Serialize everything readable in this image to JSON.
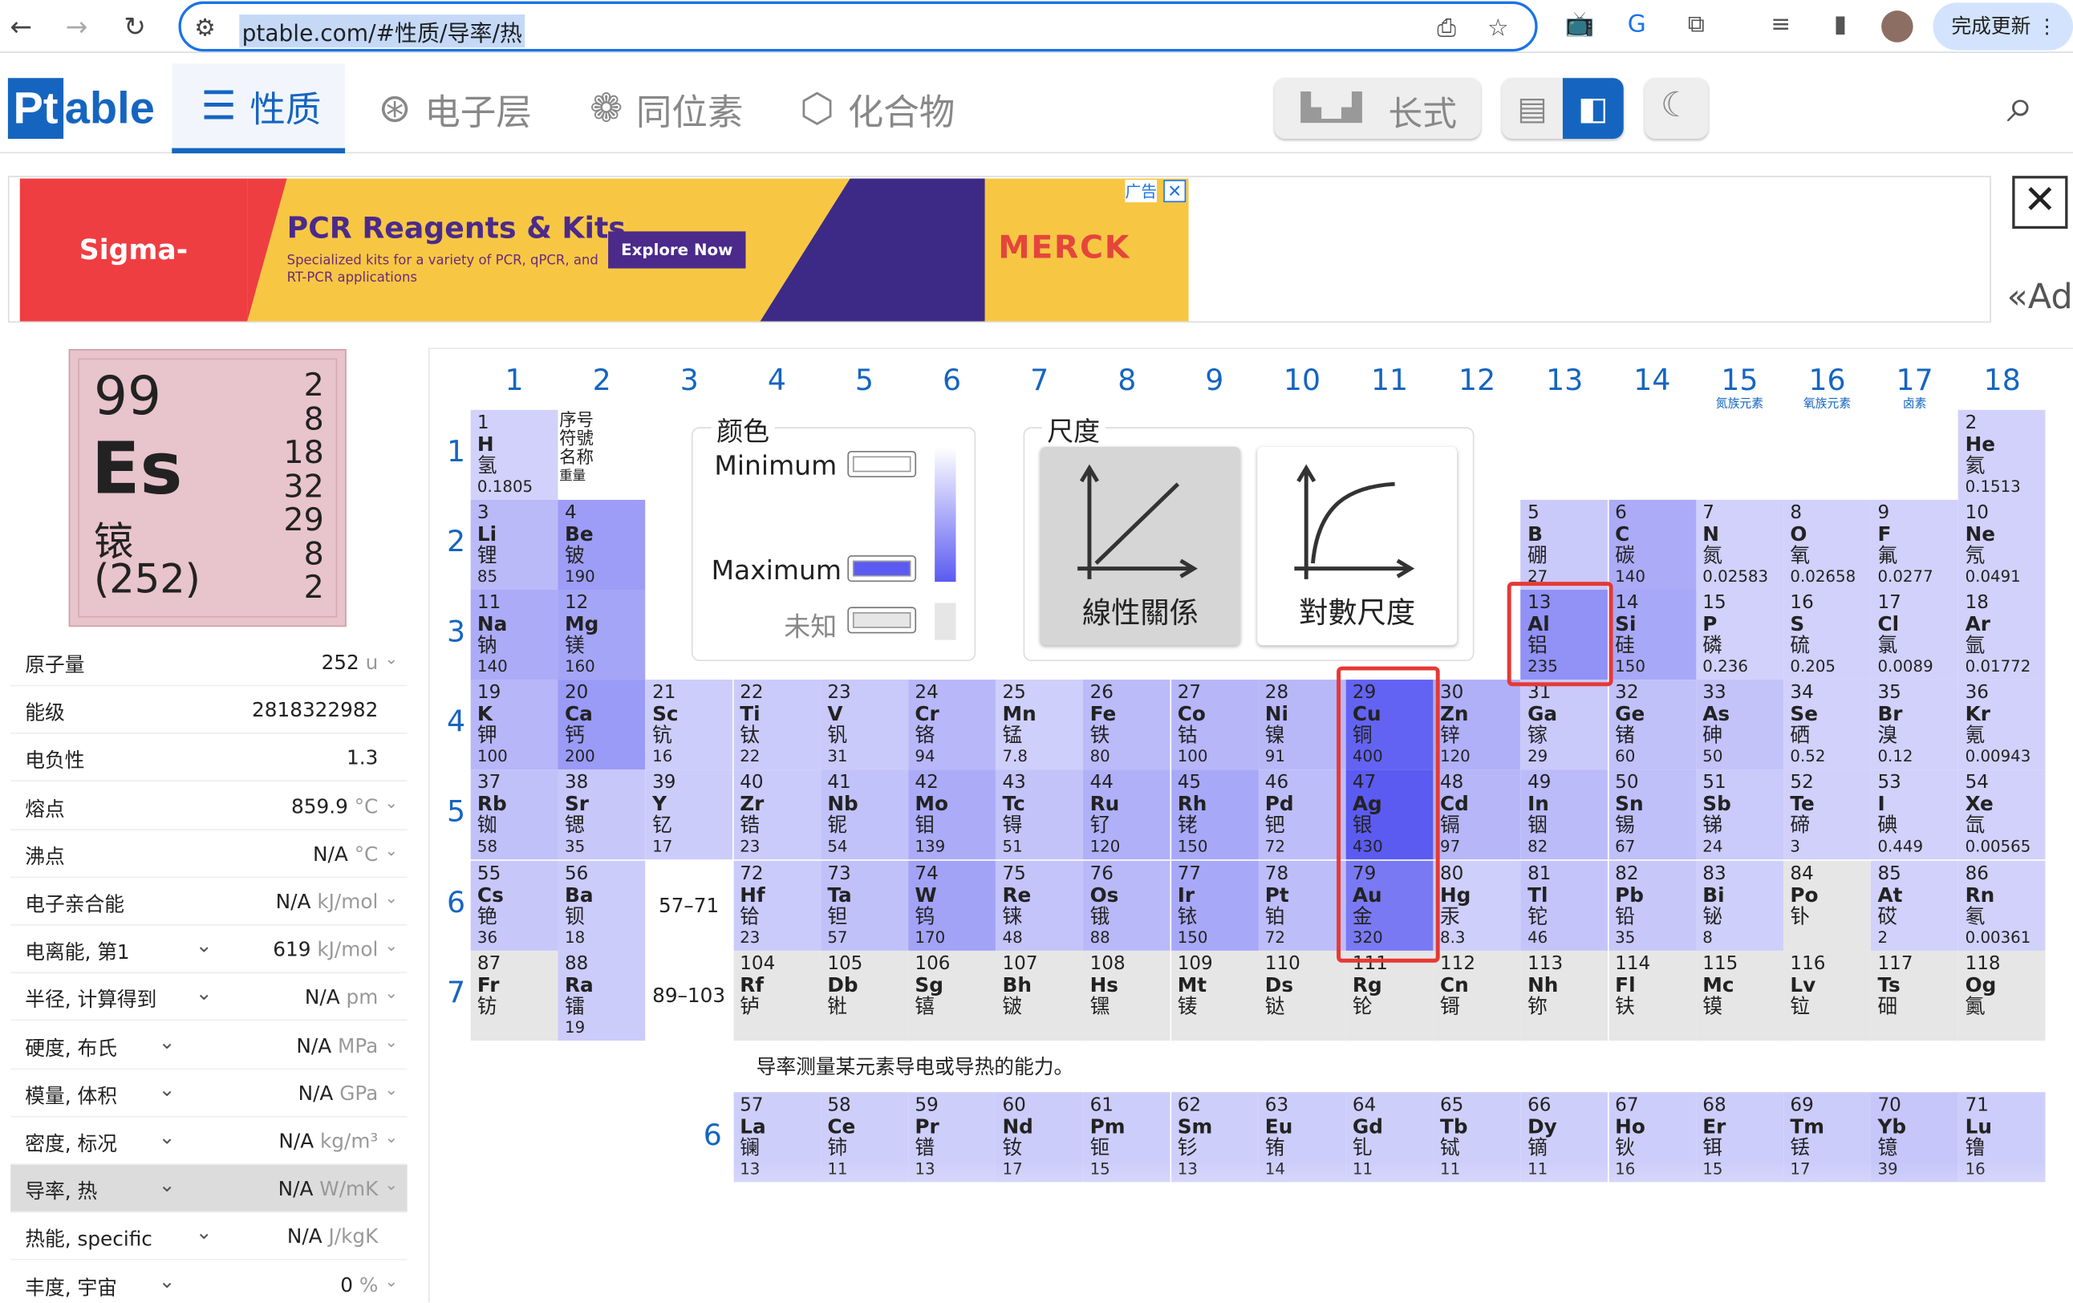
{
  "browser": {
    "url": "ptable.com/#性质/导率/热",
    "update_label": "完成更新"
  },
  "app": {
    "logo_pt": "Pt",
    "logo_able": "able",
    "tabs": [
      {
        "label": "性质",
        "icon": "list-icon",
        "active": true
      },
      {
        "label": "电子层",
        "icon": "atom-icon",
        "active": false
      },
      {
        "label": "同位素",
        "icon": "isotope-icon",
        "active": false
      },
      {
        "label": "化合物",
        "icon": "molecule-icon",
        "active": false
      }
    ],
    "layout_label": "长式"
  },
  "ad": {
    "brand": "Sigma-Aldrich.",
    "title": "PCR Reagents & Kits",
    "subtitle": "Specialized kits for a variety of PCR, qPCR, and RT-PCR applications",
    "button": "Explore Now",
    "sponsor": "MERCK",
    "tag": "广告",
    "side_text": "«Ad"
  },
  "selected": {
    "number": "99",
    "symbol": "Es",
    "name": "锿",
    "weight": "(252)",
    "shells": [
      "2",
      "8",
      "18",
      "32",
      "29",
      "8",
      "2"
    ],
    "color": "#e8c4cc"
  },
  "properties": [
    {
      "label": "原子量",
      "value": "252",
      "unit": "u",
      "chev": true,
      "dd": false
    },
    {
      "label": "能级",
      "value": "2818322982",
      "unit": "",
      "chev": false,
      "dd": false
    },
    {
      "label": "电负性",
      "value": "1.3",
      "unit": "",
      "chev": false,
      "dd": false
    },
    {
      "label": "熔点",
      "value": "859.9",
      "unit": "°C",
      "chev": true,
      "dd": false
    },
    {
      "label": "沸点",
      "value": "N/A",
      "unit": "°C",
      "chev": true,
      "dd": false
    },
    {
      "label": "电子亲合能",
      "value": "N/A",
      "unit": "kJ/mol",
      "chev": true,
      "dd": false
    },
    {
      "label": "电离能, 第1",
      "value": "619",
      "unit": "kJ/mol",
      "chev": true,
      "dd": true
    },
    {
      "label": "半径, 计算得到",
      "value": "N/A",
      "unit": "pm",
      "chev": true,
      "dd": true
    },
    {
      "label": "硬度, 布氏",
      "value": "N/A",
      "unit": "MPa",
      "chev": true,
      "dd": true
    },
    {
      "label": "模量, 体积",
      "value": "N/A",
      "unit": "GPa",
      "chev": true,
      "dd": true
    },
    {
      "label": "密度, 标况",
      "value": "N/A",
      "unit": "kg/m³",
      "chev": true,
      "dd": true
    },
    {
      "label": "导率, 热",
      "value": "N/A",
      "unit": "W/mK",
      "chev": true,
      "dd": true,
      "highlight": true
    },
    {
      "label": "热能, specific",
      "value": "N/A",
      "unit": "J/kgK",
      "chev": false,
      "dd": true
    },
    {
      "label": "丰度, 宇宙",
      "value": "0",
      "unit": "%",
      "chev": true,
      "dd": true
    }
  ],
  "groups": [
    "1",
    "2",
    "3",
    "4",
    "5",
    "6",
    "7",
    "8",
    "9",
    "10",
    "11",
    "12",
    "13",
    "14",
    "15",
    "16",
    "17",
    "18"
  ],
  "group_subtitles": {
    "15": "氮族元素",
    "16": "氧族元素",
    "17": "卤素"
  },
  "periods": [
    "1",
    "2",
    "3",
    "4",
    "5",
    "6",
    "7"
  ],
  "key": [
    "序号",
    "符號",
    "名称",
    "重量"
  ],
  "placeholders": {
    "p6": "57–71",
    "p7": "89–103"
  },
  "legend": {
    "title": "颜色",
    "min_label": "Minimum",
    "max_label": "Maximum",
    "unknown_label": "未知",
    "min_color": "#ffffff",
    "max_color": "#5b5bf2",
    "unknown_color": "#e6e6e6"
  },
  "scale": {
    "title": "尺度",
    "linear_label": "線性關係",
    "log_label": "對數尺度",
    "active": "linear"
  },
  "note": "导率测量某元素导电或导热的能力。",
  "lanthanide_row_label": "6",
  "elements": [
    {
      "n": 1,
      "s": "H",
      "c": "氢",
      "v": "0.1805",
      "g": 1,
      "p": 1
    },
    {
      "n": 2,
      "s": "He",
      "c": "氦",
      "v": "0.1513",
      "g": 18,
      "p": 1
    },
    {
      "n": 3,
      "s": "Li",
      "c": "锂",
      "v": "85",
      "g": 1,
      "p": 2
    },
    {
      "n": 4,
      "s": "Be",
      "c": "铍",
      "v": "190",
      "g": 2,
      "p": 2
    },
    {
      "n": 5,
      "s": "B",
      "c": "硼",
      "v": "27",
      "g": 13,
      "p": 2
    },
    {
      "n": 6,
      "s": "C",
      "c": "碳",
      "v": "140",
      "g": 14,
      "p": 2
    },
    {
      "n": 7,
      "s": "N",
      "c": "氮",
      "v": "0.02583",
      "g": 15,
      "p": 2
    },
    {
      "n": 8,
      "s": "O",
      "c": "氧",
      "v": "0.02658",
      "g": 16,
      "p": 2
    },
    {
      "n": 9,
      "s": "F",
      "c": "氟",
      "v": "0.0277",
      "g": 17,
      "p": 2
    },
    {
      "n": 10,
      "s": "Ne",
      "c": "氖",
      "v": "0.0491",
      "g": 18,
      "p": 2
    },
    {
      "n": 11,
      "s": "Na",
      "c": "钠",
      "v": "140",
      "g": 1,
      "p": 3
    },
    {
      "n": 12,
      "s": "Mg",
      "c": "镁",
      "v": "160",
      "g": 2,
      "p": 3
    },
    {
      "n": 13,
      "s": "Al",
      "c": "铝",
      "v": "235",
      "g": 13,
      "p": 3
    },
    {
      "n": 14,
      "s": "Si",
      "c": "硅",
      "v": "150",
      "g": 14,
      "p": 3
    },
    {
      "n": 15,
      "s": "P",
      "c": "磷",
      "v": "0.236",
      "g": 15,
      "p": 3
    },
    {
      "n": 16,
      "s": "S",
      "c": "硫",
      "v": "0.205",
      "g": 16,
      "p": 3
    },
    {
      "n": 17,
      "s": "Cl",
      "c": "氯",
      "v": "0.0089",
      "g": 17,
      "p": 3
    },
    {
      "n": 18,
      "s": "Ar",
      "c": "氩",
      "v": "0.01772",
      "g": 18,
      "p": 3
    },
    {
      "n": 19,
      "s": "K",
      "c": "钾",
      "v": "100",
      "g": 1,
      "p": 4
    },
    {
      "n": 20,
      "s": "Ca",
      "c": "钙",
      "v": "200",
      "g": 2,
      "p": 4
    },
    {
      "n": 21,
      "s": "Sc",
      "c": "钪",
      "v": "16",
      "g": 3,
      "p": 4
    },
    {
      "n": 22,
      "s": "Ti",
      "c": "钛",
      "v": "22",
      "g": 4,
      "p": 4
    },
    {
      "n": 23,
      "s": "V",
      "c": "钒",
      "v": "31",
      "g": 5,
      "p": 4
    },
    {
      "n": 24,
      "s": "Cr",
      "c": "铬",
      "v": "94",
      "g": 6,
      "p": 4
    },
    {
      "n": 25,
      "s": "Mn",
      "c": "锰",
      "v": "7.8",
      "g": 7,
      "p": 4
    },
    {
      "n": 26,
      "s": "Fe",
      "c": "铁",
      "v": "80",
      "g": 8,
      "p": 4
    },
    {
      "n": 27,
      "s": "Co",
      "c": "钴",
      "v": "100",
      "g": 9,
      "p": 4
    },
    {
      "n": 28,
      "s": "Ni",
      "c": "镍",
      "v": "91",
      "g": 10,
      "p": 4
    },
    {
      "n": 29,
      "s": "Cu",
      "c": "铜",
      "v": "400",
      "g": 11,
      "p": 4
    },
    {
      "n": 30,
      "s": "Zn",
      "c": "锌",
      "v": "120",
      "g": 12,
      "p": 4
    },
    {
      "n": 31,
      "s": "Ga",
      "c": "镓",
      "v": "29",
      "g": 13,
      "p": 4
    },
    {
      "n": 32,
      "s": "Ge",
      "c": "锗",
      "v": "60",
      "g": 14,
      "p": 4
    },
    {
      "n": 33,
      "s": "As",
      "c": "砷",
      "v": "50",
      "g": 15,
      "p": 4
    },
    {
      "n": 34,
      "s": "Se",
      "c": "硒",
      "v": "0.52",
      "g": 16,
      "p": 4
    },
    {
      "n": 35,
      "s": "Br",
      "c": "溴",
      "v": "0.12",
      "g": 17,
      "p": 4
    },
    {
      "n": 36,
      "s": "Kr",
      "c": "氪",
      "v": "0.00943",
      "g": 18,
      "p": 4
    },
    {
      "n": 37,
      "s": "Rb",
      "c": "铷",
      "v": "58",
      "g": 1,
      "p": 5
    },
    {
      "n": 38,
      "s": "Sr",
      "c": "锶",
      "v": "35",
      "g": 2,
      "p": 5
    },
    {
      "n": 39,
      "s": "Y",
      "c": "钇",
      "v": "17",
      "g": 3,
      "p": 5
    },
    {
      "n": 40,
      "s": "Zr",
      "c": "锆",
      "v": "23",
      "g": 4,
      "p": 5
    },
    {
      "n": 41,
      "s": "Nb",
      "c": "铌",
      "v": "54",
      "g": 5,
      "p": 5
    },
    {
      "n": 42,
      "s": "Mo",
      "c": "钼",
      "v": "139",
      "g": 6,
      "p": 5
    },
    {
      "n": 43,
      "s": "Tc",
      "c": "锝",
      "v": "51",
      "g": 7,
      "p": 5
    },
    {
      "n": 44,
      "s": "Ru",
      "c": "钌",
      "v": "120",
      "g": 8,
      "p": 5
    },
    {
      "n": 45,
      "s": "Rh",
      "c": "铑",
      "v": "150",
      "g": 9,
      "p": 5
    },
    {
      "n": 46,
      "s": "Pd",
      "c": "钯",
      "v": "72",
      "g": 10,
      "p": 5
    },
    {
      "n": 47,
      "s": "Ag",
      "c": "银",
      "v": "430",
      "g": 11,
      "p": 5
    },
    {
      "n": 48,
      "s": "Cd",
      "c": "镉",
      "v": "97",
      "g": 12,
      "p": 5
    },
    {
      "n": 49,
      "s": "In",
      "c": "铟",
      "v": "82",
      "g": 13,
      "p": 5
    },
    {
      "n": 50,
      "s": "Sn",
      "c": "锡",
      "v": "67",
      "g": 14,
      "p": 5
    },
    {
      "n": 51,
      "s": "Sb",
      "c": "锑",
      "v": "24",
      "g": 15,
      "p": 5
    },
    {
      "n": 52,
      "s": "Te",
      "c": "碲",
      "v": "3",
      "g": 16,
      "p": 5
    },
    {
      "n": 53,
      "s": "I",
      "c": "碘",
      "v": "0.449",
      "g": 17,
      "p": 5
    },
    {
      "n": 54,
      "s": "Xe",
      "c": "氙",
      "v": "0.00565",
      "g": 18,
      "p": 5
    },
    {
      "n": 55,
      "s": "Cs",
      "c": "铯",
      "v": "36",
      "g": 1,
      "p": 6
    },
    {
      "n": 56,
      "s": "Ba",
      "c": "钡",
      "v": "18",
      "g": 2,
      "p": 6
    },
    {
      "n": 72,
      "s": "Hf",
      "c": "铪",
      "v": "23",
      "g": 4,
      "p": 6
    },
    {
      "n": 73,
      "s": "Ta",
      "c": "钽",
      "v": "57",
      "g": 5,
      "p": 6
    },
    {
      "n": 74,
      "s": "W",
      "c": "钨",
      "v": "170",
      "g": 6,
      "p": 6
    },
    {
      "n": 75,
      "s": "Re",
      "c": "铼",
      "v": "48",
      "g": 7,
      "p": 6
    },
    {
      "n": 76,
      "s": "Os",
      "c": "锇",
      "v": "88",
      "g": 8,
      "p": 6
    },
    {
      "n": 77,
      "s": "Ir",
      "c": "铱",
      "v": "150",
      "g": 9,
      "p": 6
    },
    {
      "n": 78,
      "s": "Pt",
      "c": "铂",
      "v": "72",
      "g": 10,
      "p": 6
    },
    {
      "n": 79,
      "s": "Au",
      "c": "金",
      "v": "320",
      "g": 11,
      "p": 6
    },
    {
      "n": 80,
      "s": "Hg",
      "c": "汞",
      "v": "8.3",
      "g": 12,
      "p": 6
    },
    {
      "n": 81,
      "s": "Tl",
      "c": "铊",
      "v": "46",
      "g": 13,
      "p": 6
    },
    {
      "n": 82,
      "s": "Pb",
      "c": "铅",
      "v": "35",
      "g": 14,
      "p": 6
    },
    {
      "n": 83,
      "s": "Bi",
      "c": "铋",
      "v": "8",
      "g": 15,
      "p": 6
    },
    {
      "n": 84,
      "s": "Po",
      "c": "钋",
      "v": "",
      "g": 16,
      "p": 6
    },
    {
      "n": 85,
      "s": "At",
      "c": "砹",
      "v": "2",
      "g": 17,
      "p": 6
    },
    {
      "n": 86,
      "s": "Rn",
      "c": "氡",
      "v": "0.00361",
      "g": 18,
      "p": 6
    },
    {
      "n": 87,
      "s": "Fr",
      "c": "钫",
      "v": "",
      "g": 1,
      "p": 7
    },
    {
      "n": 88,
      "s": "Ra",
      "c": "镭",
      "v": "19",
      "g": 2,
      "p": 7
    },
    {
      "n": 104,
      "s": "Rf",
      "c": "𬬻",
      "v": "",
      "g": 4,
      "p": 7
    },
    {
      "n": 105,
      "s": "Db",
      "c": "𬭊",
      "v": "",
      "g": 5,
      "p": 7
    },
    {
      "n": 106,
      "s": "Sg",
      "c": "𬭳",
      "v": "",
      "g": 6,
      "p": 7
    },
    {
      "n": 107,
      "s": "Bh",
      "c": "𬭛",
      "v": "",
      "g": 7,
      "p": 7
    },
    {
      "n": 108,
      "s": "Hs",
      "c": "𬭶",
      "v": "",
      "g": 8,
      "p": 7
    },
    {
      "n": 109,
      "s": "Mt",
      "c": "鿏",
      "v": "",
      "g": 9,
      "p": 7
    },
    {
      "n": 110,
      "s": "Ds",
      "c": "𫟼",
      "v": "",
      "g": 10,
      "p": 7
    },
    {
      "n": 111,
      "s": "Rg",
      "c": "𬬭",
      "v": "",
      "g": 11,
      "p": 7
    },
    {
      "n": 112,
      "s": "Cn",
      "c": "鿔",
      "v": "",
      "g": 12,
      "p": 7
    },
    {
      "n": 113,
      "s": "Nh",
      "c": "鿭",
      "v": "",
      "g": 13,
      "p": 7
    },
    {
      "n": 114,
      "s": "Fl",
      "c": "𫓧",
      "v": "",
      "g": 14,
      "p": 7
    },
    {
      "n": 115,
      "s": "Mc",
      "c": "镆",
      "v": "",
      "g": 15,
      "p": 7
    },
    {
      "n": 116,
      "s": "Lv",
      "c": "𫟷",
      "v": "",
      "g": 16,
      "p": 7
    },
    {
      "n": 117,
      "s": "Ts",
      "c": "鿬",
      "v": "",
      "g": 17,
      "p": 7
    },
    {
      "n": 118,
      "s": "Og",
      "c": "鿫",
      "v": "",
      "g": 18,
      "p": 7
    }
  ],
  "lanthanides": [
    {
      "n": 57,
      "s": "La",
      "c": "镧",
      "v": "13"
    },
    {
      "n": 58,
      "s": "Ce",
      "c": "铈",
      "v": "11"
    },
    {
      "n": 59,
      "s": "Pr",
      "c": "镨",
      "v": "13"
    },
    {
      "n": 60,
      "s": "Nd",
      "c": "钕",
      "v": "17"
    },
    {
      "n": 61,
      "s": "Pm",
      "c": "钷",
      "v": "15"
    },
    {
      "n": 62,
      "s": "Sm",
      "c": "钐",
      "v": "13"
    },
    {
      "n": 63,
      "s": "Eu",
      "c": "铕",
      "v": "14"
    },
    {
      "n": 64,
      "s": "Gd",
      "c": "钆",
      "v": "11"
    },
    {
      "n": 65,
      "s": "Tb",
      "c": "铽",
      "v": "11"
    },
    {
      "n": 66,
      "s": "Dy",
      "c": "镝",
      "v": "11"
    },
    {
      "n": 67,
      "s": "Ho",
      "c": "钬",
      "v": "16"
    },
    {
      "n": 68,
      "s": "Er",
      "c": "铒",
      "v": "15"
    },
    {
      "n": 69,
      "s": "Tm",
      "c": "铥",
      "v": "17"
    },
    {
      "n": 70,
      "s": "Yb",
      "c": "镱",
      "v": "39"
    },
    {
      "n": 71,
      "s": "Lu",
      "c": "镥",
      "v": "16"
    }
  ],
  "highlighted_elements": [
    13,
    29,
    47,
    79
  ]
}
